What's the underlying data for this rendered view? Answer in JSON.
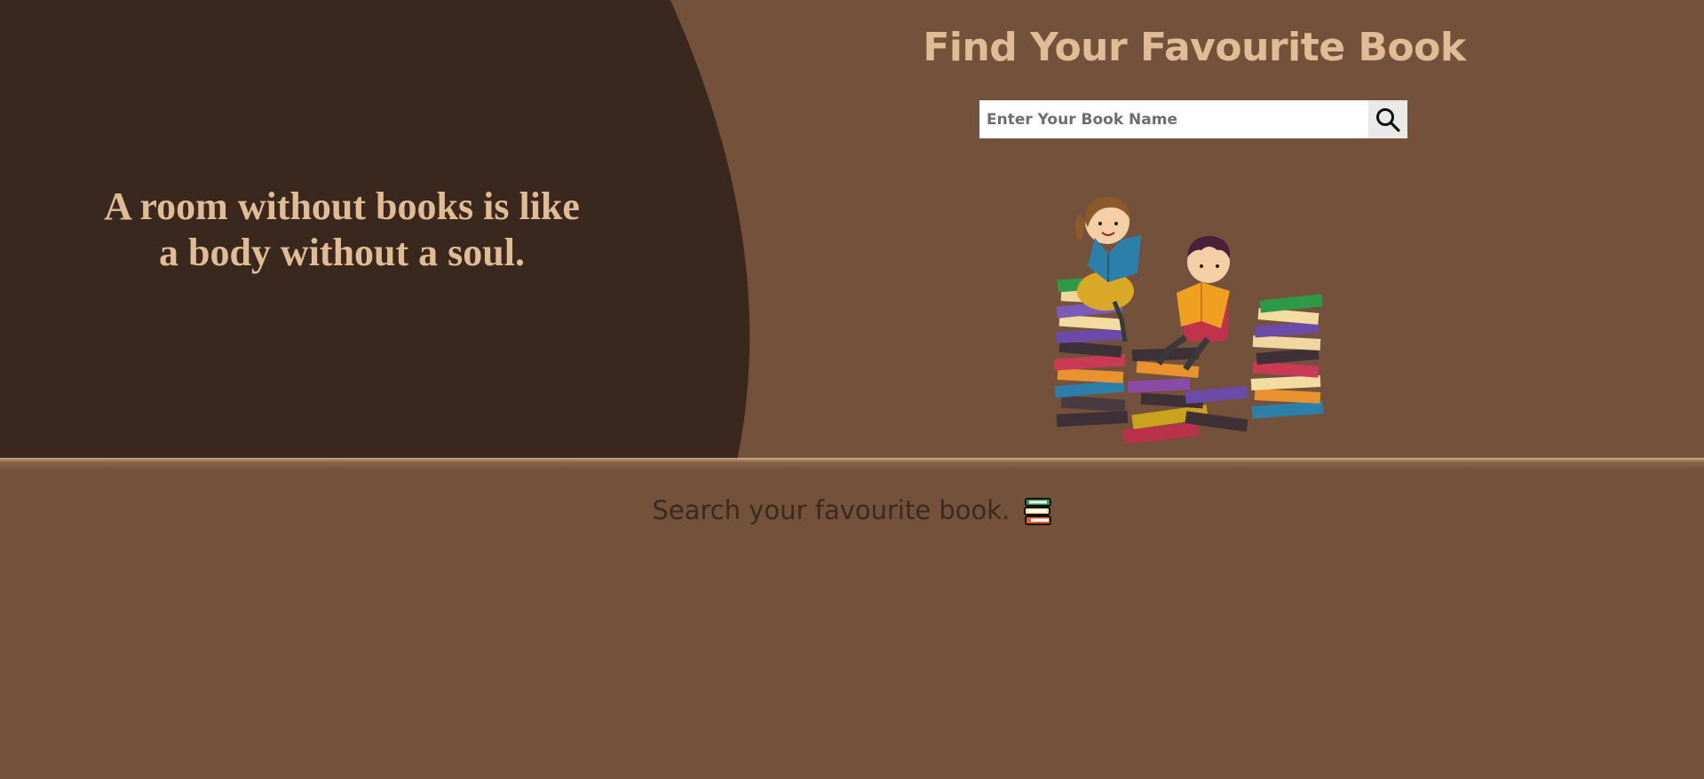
{
  "hero": {
    "quote_line1": "A room without books is like",
    "quote_line2": "a body without a soul.",
    "title": "Find Your Favourite Book",
    "search": {
      "placeholder": "Enter Your Book Name",
      "value": "",
      "button_icon": "search-icon"
    },
    "illustration": "kids-reading-books-illustration"
  },
  "main": {
    "tagline": "Search your favourite book.",
    "tagline_icon": "books-icon"
  },
  "colors": {
    "background": "#74513a",
    "dark_arc": "#3a281e",
    "accent_text": "#e0bc96",
    "body_text": "#3b2a20"
  }
}
